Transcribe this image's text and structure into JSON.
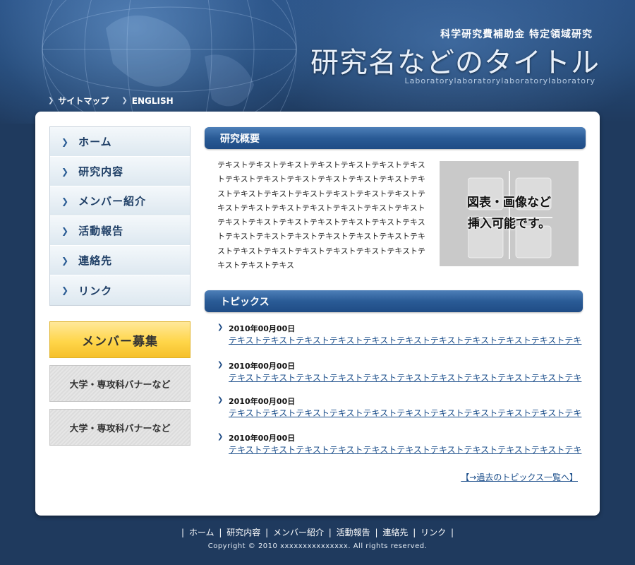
{
  "header": {
    "subtitle": "科学研究費補助金 特定領域研究",
    "title": "研究名などのタイトル",
    "lab_name": "Laboratorylaboratorylaboratorylaboratory",
    "links": [
      {
        "label": "サイトマップ"
      },
      {
        "label": "ENGLISH"
      }
    ]
  },
  "sidebar": {
    "items": [
      {
        "label": "ホーム"
      },
      {
        "label": "研究内容"
      },
      {
        "label": "メンバー紹介"
      },
      {
        "label": "活動報告"
      },
      {
        "label": "連絡先"
      },
      {
        "label": "リンク"
      }
    ],
    "recruit_banner": "メンバー募集",
    "banners": [
      {
        "label": "大学・専攻科バナーなど"
      },
      {
        "label": "大学・専攻科バナーなど"
      }
    ]
  },
  "overview": {
    "heading": "研究概要",
    "body": "テキストテキストテキストテキストテキストテキストテキストテキストテキストテキストテキストテキストテキストテキストテキストテキストテキストテキストテキストテキストテキストテキストテキストテキストテキストテキストテキストテキストテキストテキストテキストテキストテキストテキストテキストテキストテキストテキストテキストテキストテキストテキストテキストテキストテキストテキストテキストテキストテキストテキス",
    "figure_text_line1": "図表・画像など",
    "figure_text_line2": "挿入可能です。"
  },
  "topics": {
    "heading": "トピックス",
    "items": [
      {
        "date": "2010年00月00日",
        "text": "テキストテキストテキストテキストテキストテキストテキストテキストテキストテキストテキ"
      },
      {
        "date": "2010年00月00日",
        "text": "テキストテキストテキストテキストテキストテキストテキストテキストテキストテキストテキ"
      },
      {
        "date": "2010年00月00日",
        "text": "テキストテキストテキストテキストテキストテキストテキストテキストテキストテキストテキ"
      },
      {
        "date": "2010年00月00日",
        "text": "テキストテキストテキストテキストテキストテキストテキストテキストテキストテキストテキ"
      }
    ],
    "more_link": "【→過去のトピックス一覧へ】"
  },
  "footer": {
    "links": [
      {
        "label": "ホーム"
      },
      {
        "label": "研究内容"
      },
      {
        "label": "メンバー紹介"
      },
      {
        "label": "活動報告"
      },
      {
        "label": "連絡先"
      },
      {
        "label": "リンク"
      }
    ],
    "copyright": "Copyright © 2010 xxxxxxxxxxxxxxx. All rights reserved."
  },
  "colors": {
    "page_bg": "#1f3a5e",
    "header_accent": "#2a5184",
    "section_head": "#2a5b96",
    "recruit_yellow": "#ffd64a",
    "link": "#1a4d8a"
  },
  "icons": {
    "nav_arrow": "chevron-right-icon",
    "topic_arrow": "chevron-right-icon"
  }
}
